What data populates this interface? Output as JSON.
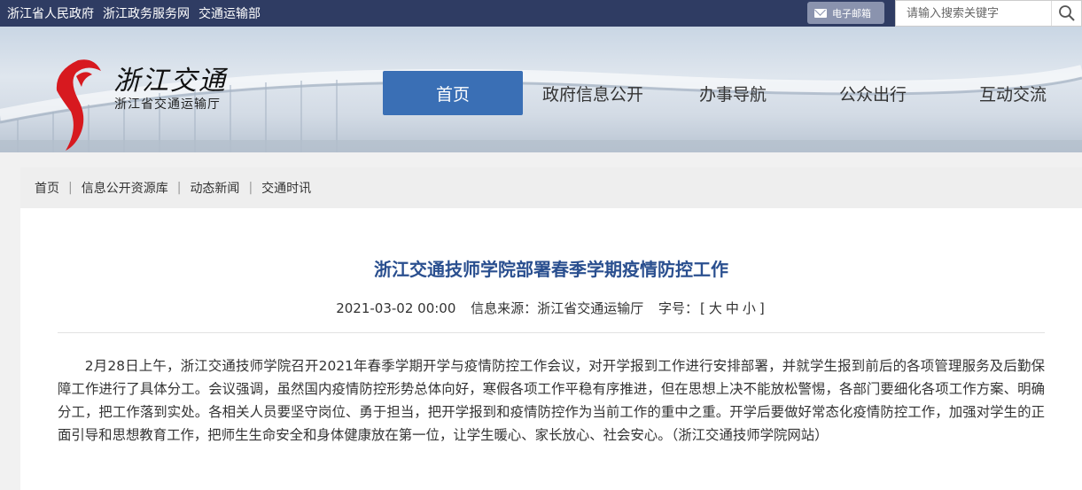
{
  "topbar": {
    "links": [
      "浙江省人民政府",
      "浙江政务服务网",
      "交通运输部"
    ],
    "mail_label": "电子邮箱",
    "search_placeholder": "请输入搜索关键字"
  },
  "header": {
    "logo_title": "浙江交通",
    "logo_subtitle": "浙江省交通运输厅",
    "nav": [
      "首页",
      "政府信息公开",
      "办事导航",
      "公众出行",
      "互动交流"
    ],
    "active_nav": "首页"
  },
  "breadcrumb": [
    "首页",
    "信息公开资源库",
    "动态新闻",
    "交通时讯"
  ],
  "article": {
    "title": "浙江交通技师学院部署春季学期疫情防控工作",
    "date": "2021-03-02 00:00",
    "source_label": "信息来源：",
    "source": "浙江省交通运输厅",
    "fontsize_label": "字号：",
    "fontsize_open": "[",
    "fontsize_options": [
      "大",
      "中",
      "小"
    ],
    "fontsize_close": "]",
    "body": "2月28日上午，浙江交通技师学院召开2021年春季学期开学与疫情防控工作会议，对开学报到工作进行安排部署，并就学生报到前后的各项管理服务及后勤保障工作进行了具体分工。会议强调，虽然国内疫情防控形势总体向好，寒假各项工作平稳有序推进，但在思想上决不能放松警惕，各部门要细化各项工作方案、明确分工，把工作落到实处。各相关人员要坚守岗位、勇于担当，把开学报到和疫情防控作为当前工作的重中之重。开学后要做好常态化疫情防控工作，加强对学生的正面引导和思想教育工作，把师生生命安全和身体健康放在第一位，让学生暖心、家长放心、社会安心。（浙江交通技师学院网站）"
  },
  "colors": {
    "topbar": "#2f3c63",
    "nav_active": "#3a6fb5",
    "title": "#2a4f8f",
    "logo_red": "#d7191f"
  }
}
